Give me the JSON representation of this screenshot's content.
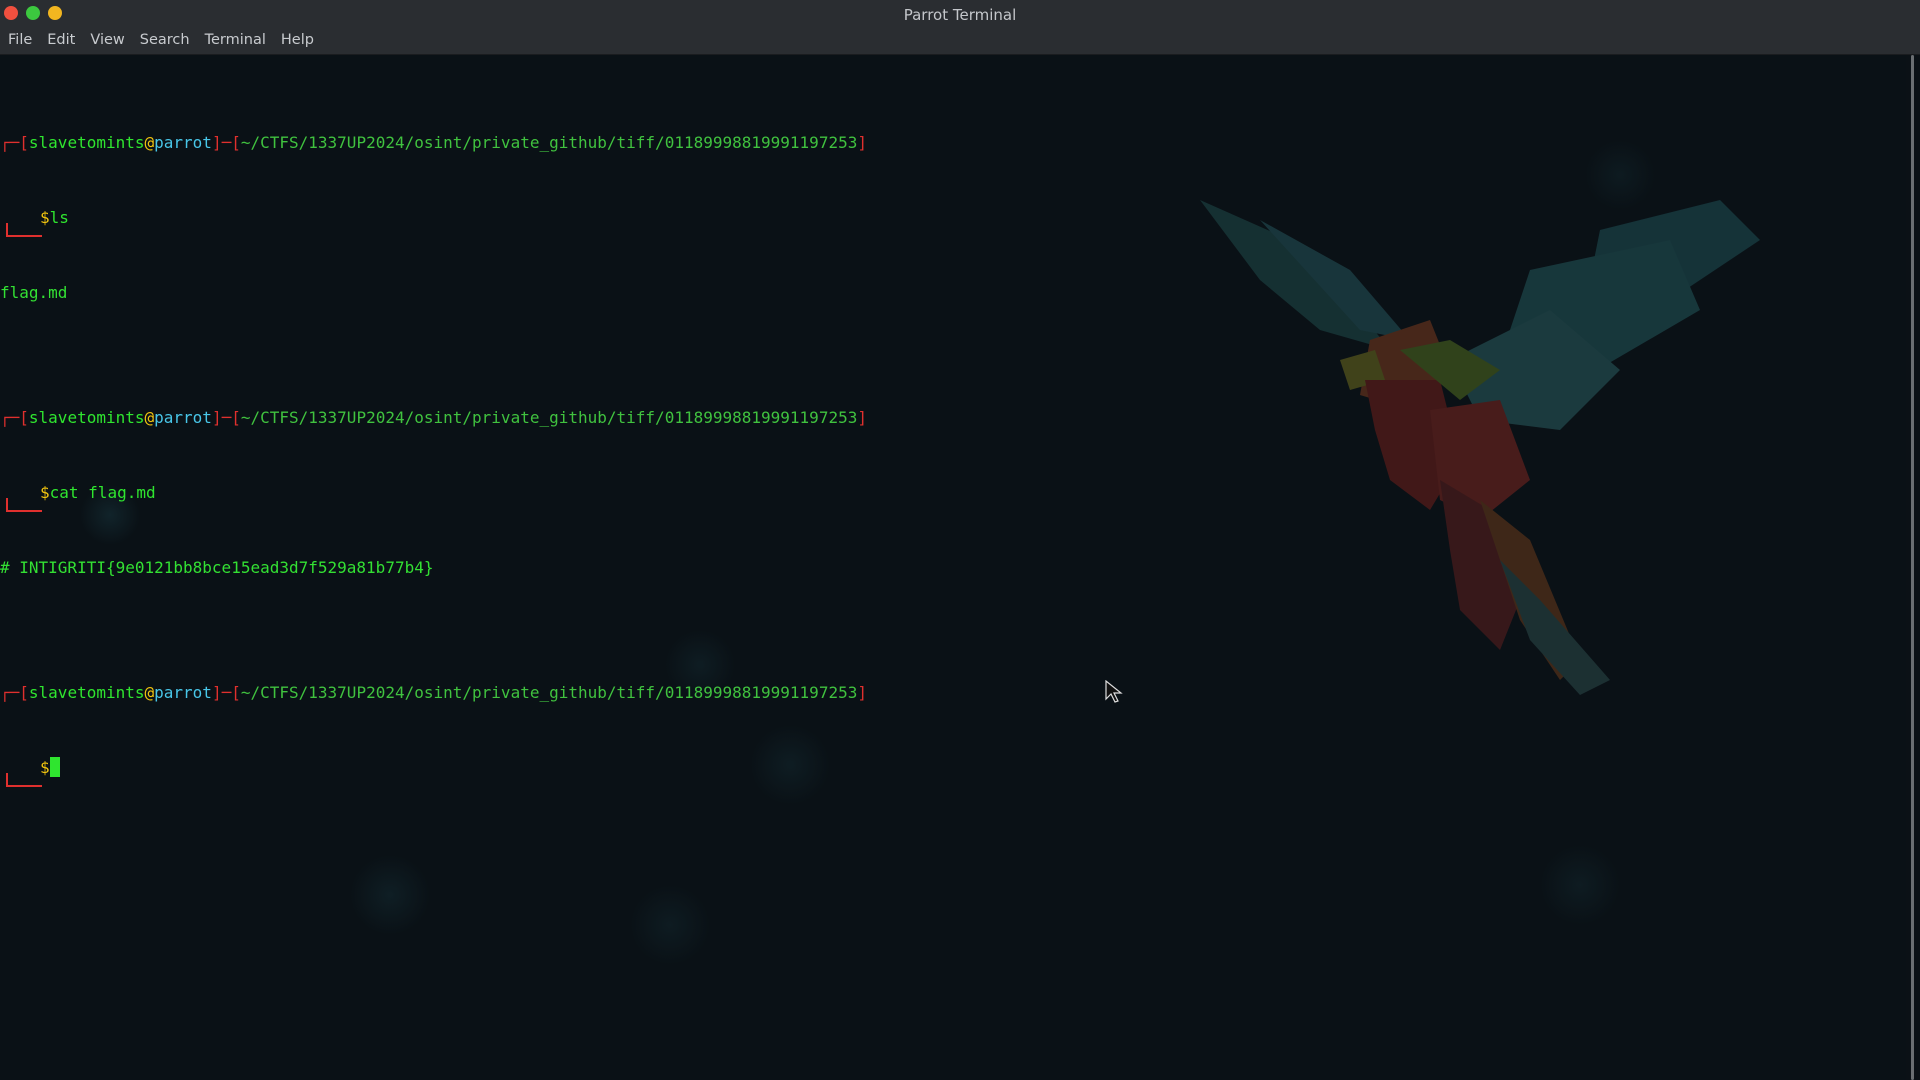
{
  "window": {
    "title": "Parrot Terminal",
    "traffic_lights": {
      "close_color": "#f0503f",
      "maximize_color": "#3cc83f",
      "minimize_color": "#f2b620"
    }
  },
  "menubar": {
    "items": [
      "File",
      "Edit",
      "View",
      "Search",
      "Terminal",
      "Help"
    ]
  },
  "terminal": {
    "prompt": {
      "user": "slavetomints",
      "at": "@",
      "host": "parrot",
      "separator": "]─[",
      "path": "~/CTFS/1337UP2024/osint/private_github/tiff/01189998819991197253",
      "open_bracket": "┌─[",
      "close_bracket": "]",
      "dollar": "$"
    },
    "commands": [
      {
        "command": "ls",
        "output": "flag.md"
      },
      {
        "command": "cat flag.md",
        "output": "# INTIGRITI{9e0121bb8bce15ead3d7f529a81b77b4}"
      }
    ],
    "colors": {
      "bracket": "#e0302e",
      "user": "#2fe52f",
      "host": "#48c6e8",
      "at": "#f1c40f",
      "path": "#40c23f",
      "output": "#33e033"
    }
  },
  "icons": {
    "background_art": "parrot-logo-icon",
    "mouse": "mouse-pointer-icon"
  }
}
